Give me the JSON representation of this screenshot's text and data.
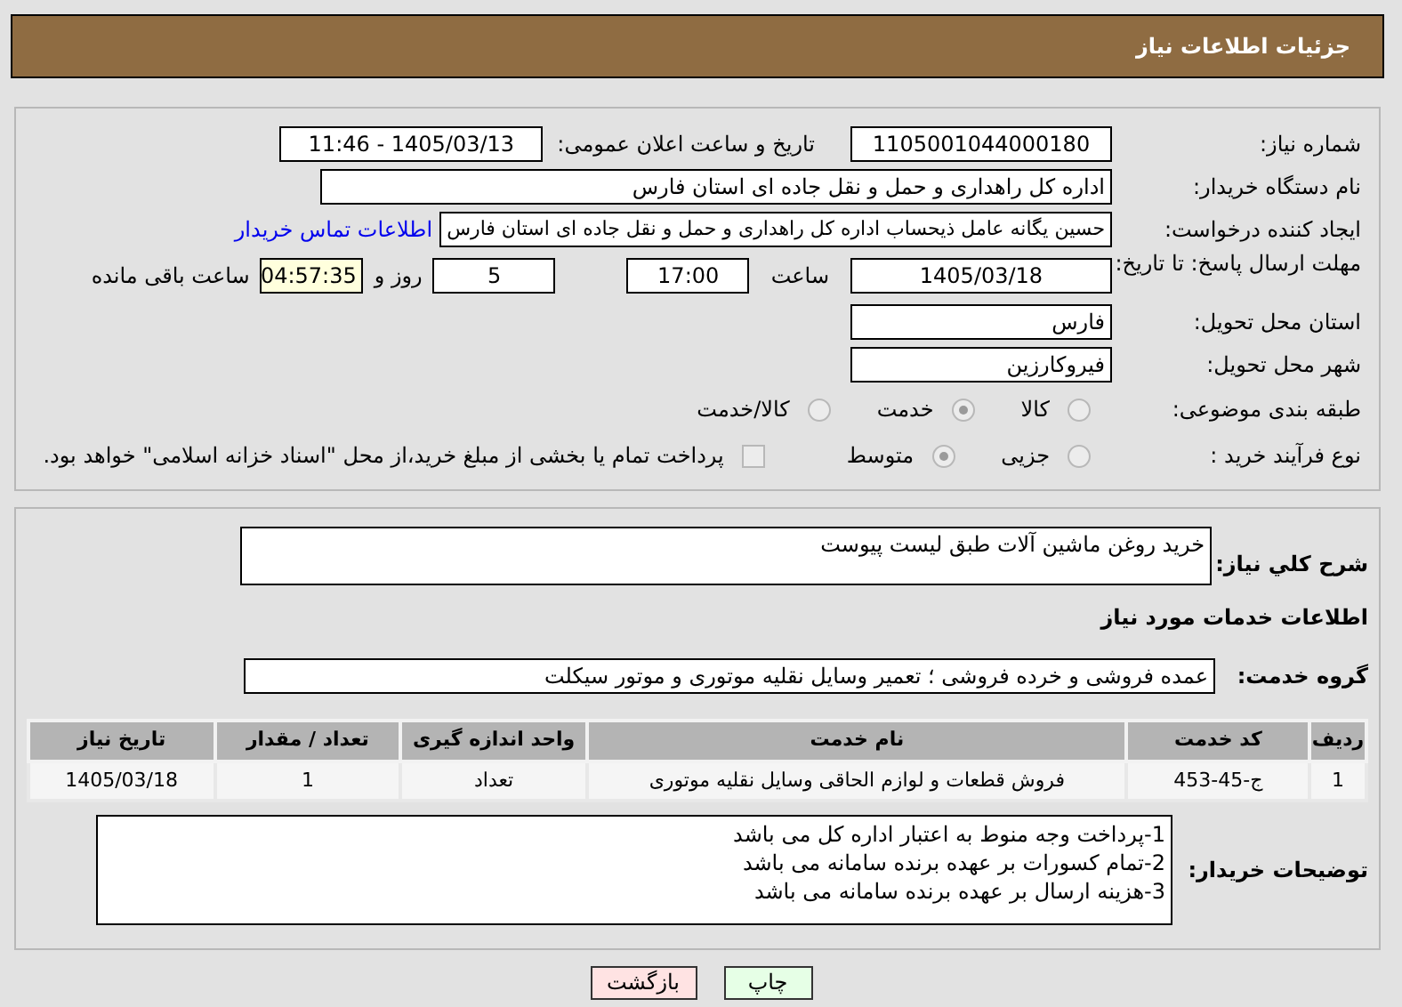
{
  "header": {
    "title": "جزئیات اطلاعات نیاز"
  },
  "need_number": {
    "label": "شماره نیاز:",
    "value": "1105001044000180"
  },
  "announce": {
    "label": "تاریخ و ساعت اعلان عمومی:",
    "value": "1405/03/13 - 11:46"
  },
  "buyer_org": {
    "label": "نام دستگاه خریدار:",
    "value": "اداره کل راهداری و حمل و نقل جاده ای استان فارس"
  },
  "requester": {
    "label": "ایجاد کننده درخواست:",
    "value": "حسین یگانه عامل ذیحساب اداره کل راهداری و حمل و نقل جاده ای استان فارس",
    "link": "اطلاعات تماس خریدار"
  },
  "deadline": {
    "label": "مهلت ارسال پاسخ: تا تاریخ:",
    "date": "1405/03/18",
    "time_label": "ساعت",
    "time": "17:00",
    "days": "5",
    "days_label": "روز و",
    "remaining": "04:57:35",
    "remaining_label": "ساعت باقی مانده"
  },
  "province": {
    "label": "استان محل تحویل:",
    "value": "فارس"
  },
  "city": {
    "label": "شهر محل تحویل:",
    "value": "فیروکارزین"
  },
  "category": {
    "label": "طبقه بندی موضوعی:",
    "options": [
      {
        "label": "کالا",
        "selected": false
      },
      {
        "label": "خدمت",
        "selected": true
      },
      {
        "label": "کالا/خدمت",
        "selected": false
      }
    ]
  },
  "process": {
    "label": "نوع فرآیند خرید :",
    "options": [
      {
        "label": "جزیی",
        "selected": false
      },
      {
        "label": "متوسط",
        "selected": true
      }
    ],
    "payment": {
      "checked": false,
      "label": "پرداخت تمام یا بخشی از مبلغ خرید،از محل \"اسناد خزانه اسلامی\" خواهد بود."
    }
  },
  "description": {
    "label": "شرح كلي نياز:",
    "value": "خرید روغن ماشین آلات طبق لیست پیوست"
  },
  "services_title": "اطلاعات خدمات مورد نیاز",
  "service_group": {
    "label": "گروه خدمت:",
    "value": "عمده فروشی و خرده فروشی ؛ تعمیر وسایل نقلیه موتوری و موتور سیکلت"
  },
  "table": {
    "columns": [
      "ردیف",
      "کد خدمت",
      "نام خدمت",
      "واحد اندازه گیری",
      "تعداد / مقدار",
      "تاریخ نیاز"
    ],
    "rows": [
      [
        "1",
        "ج-45-453",
        "فروش قطعات و لوازم الحاقی وسایل نقلیه موتوری",
        "تعداد",
        "1",
        "1405/03/18"
      ]
    ]
  },
  "notes": {
    "label": "توضیحات خریدار:",
    "lines": [
      "1-پرداخت وجه منوط به اعتبار اداره کل می باشد",
      "2-تمام کسورات بر عهده برنده سامانه می باشد",
      "3-هزینه ارسال بر عهده برنده سامانه می باشد"
    ]
  },
  "buttons": [
    {
      "kind": "print",
      "label": "چاپ"
    },
    {
      "kind": "back",
      "label": "بازگشت"
    }
  ]
}
